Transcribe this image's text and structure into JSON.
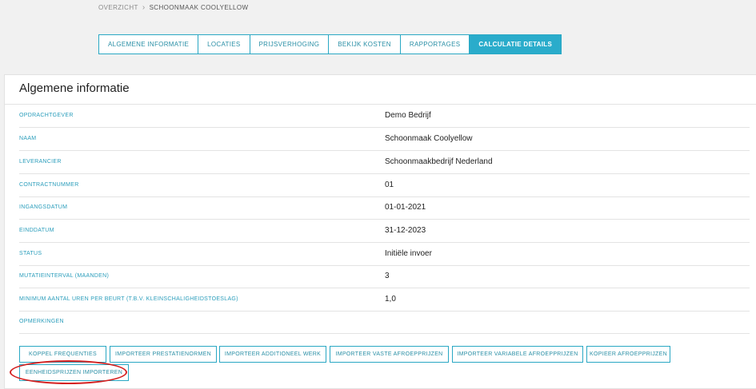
{
  "breadcrumb": {
    "root": "OVERZICHT",
    "current": "SCHOONMAAK COOLYELLOW"
  },
  "tabs": [
    {
      "label": "ALGEMENE INFORMATIE",
      "active": false
    },
    {
      "label": "LOCATIES",
      "active": false
    },
    {
      "label": "PRIJSVERHOGING",
      "active": false
    },
    {
      "label": "BEKIJK KOSTEN",
      "active": false
    },
    {
      "label": "RAPPORTAGES",
      "active": false
    },
    {
      "label": "CALCULATIE DETAILS",
      "active": true
    }
  ],
  "card": {
    "title": "Algemene informatie",
    "rows": [
      {
        "label": "OPDRACHTGEVER",
        "value": "Demo Bedrijf"
      },
      {
        "label": "NAAM",
        "value": "Schoonmaak Coolyellow"
      },
      {
        "label": "LEVERANCIER",
        "value": "Schoonmaakbedrijf Nederland"
      },
      {
        "label": "CONTRACTNUMMER",
        "value": "01"
      },
      {
        "label": "INGANGSDATUM",
        "value": "01-01-2021"
      },
      {
        "label": "EINDDATUM",
        "value": "31-12-2023"
      },
      {
        "label": "STATUS",
        "value": "Initiële invoer"
      },
      {
        "label": "MUTATIEINTERVAL (MAANDEN)",
        "value": "3"
      },
      {
        "label": "MINIMUM AANTAL UREN PER BEURT (T.B.V. KLEINSCHALIGHEIDSTOESLAG)",
        "value": "1,0"
      },
      {
        "label": "OPMERKINGEN",
        "value": ""
      }
    ]
  },
  "actions": [
    {
      "label": "KOPPEL FREQUENTIES"
    },
    {
      "label": "IMPORTEER PRESTATIENORMEN"
    },
    {
      "label": "IMPORTEER ADDITIONEEL WERK"
    },
    {
      "label": "IMPORTEER VASTE AFROEPPRIJZEN"
    },
    {
      "label": "IMPORTEER VARIABELE AFROEPPRIJZEN"
    },
    {
      "label": "KOPIEER AFROEPPRIJZEN"
    },
    {
      "label": "EENHEIDSPRIJZEN IMPORTEREN"
    }
  ],
  "colors": {
    "accent": "#2aaccb",
    "highlight": "#d42020",
    "side_tab": "#1f2d3d"
  }
}
